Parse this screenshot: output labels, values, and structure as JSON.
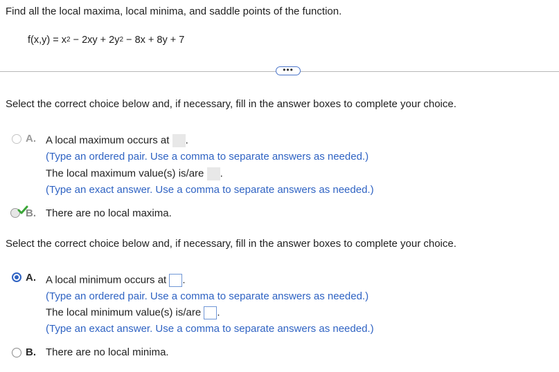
{
  "question": {
    "prompt": "Find all the local maxima, local minima, and saddle points of the function.",
    "function_parts": [
      "f(x,y) = x",
      "2",
      " − 2xy + 2y",
      "2",
      " − 8x + 8y + 7"
    ]
  },
  "more_button": "•••",
  "part1": {
    "instruction": "Select the correct choice below and, if necessary, fill in the answer boxes to complete your choice.",
    "choice_a": {
      "letter": "A.",
      "line1": "A local maximum occurs at",
      "hint1": "(Type an ordered pair. Use a comma to separate answers as needed.)",
      "line2": "The local maximum value(s) is/are",
      "hint2": "(Type an exact answer. Use a comma to separate answers as needed.)"
    },
    "choice_b": {
      "letter": "B.",
      "text": "There are no local maxima."
    }
  },
  "part2": {
    "instruction": "Select the correct choice below and, if necessary, fill in the answer boxes to complete your choice.",
    "choice_a": {
      "letter": "A.",
      "line1": "A local minimum occurs at",
      "hint1": "(Type an ordered pair. Use a comma to separate answers as needed.)",
      "line2": "The local minimum value(s) is/are",
      "hint2": "(Type an exact answer. Use a comma to separate answers as needed.)"
    },
    "choice_b": {
      "letter": "B.",
      "text": "There are no local minima."
    }
  },
  "colors": {
    "link_blue": "#2f63c3",
    "check_green": "#3aa637"
  }
}
